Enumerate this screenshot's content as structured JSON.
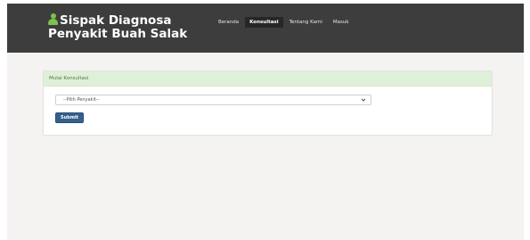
{
  "brand": {
    "line1": "Sispak Diagnosa",
    "line2": "Penyakit Buah Salak",
    "icon": "user-icon",
    "icon_color": "#7dc24b"
  },
  "nav": {
    "items": [
      {
        "label": "Beranda",
        "active": false
      },
      {
        "label": "Konsultasi",
        "active": true
      },
      {
        "label": "Tentang Kami",
        "active": false
      },
      {
        "label": "Masuk",
        "active": false
      }
    ]
  },
  "consultation": {
    "header": "Mulai Konsultasi",
    "select_value": "--Pilih Penyakit--",
    "submit_label": "Submit"
  },
  "colors": {
    "navbar": "#3d3d3d",
    "header_bg": "#dff0d8",
    "button": "#355f8c",
    "page_bg": "#f4f3f1"
  }
}
